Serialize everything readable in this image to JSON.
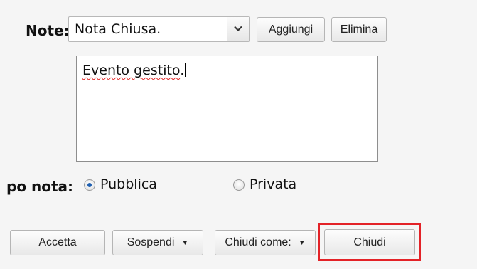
{
  "note": {
    "label": "Note:",
    "selected": "Nota Chiusa.",
    "add_label": "Aggiungi",
    "delete_label": "Elimina"
  },
  "textarea": {
    "misspelled": "Evento gestito",
    "rest": "."
  },
  "tipo_nota": {
    "label": "po nota:",
    "options": [
      {
        "label": "Pubblica",
        "checked": true
      },
      {
        "label": "Privata",
        "checked": false
      }
    ]
  },
  "actions": {
    "accept_label": "Accetta",
    "suspend_label": "Sospendi",
    "close_as_label": "Chiudi come:",
    "close_label": "Chiudi"
  },
  "colors": {
    "highlight": "#e32227",
    "radio_checked": "#1f5fb0"
  }
}
